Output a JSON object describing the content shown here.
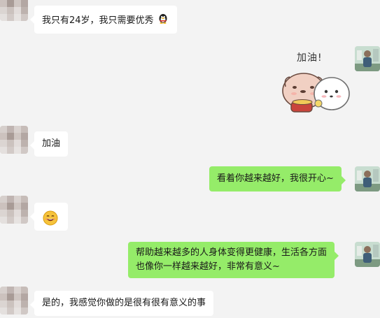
{
  "messages": [
    {
      "side": "left",
      "type": "text",
      "text": "我只有24岁，我只需要优秀",
      "emoji": "qq-penguin-icon"
    },
    {
      "side": "right",
      "type": "sticker",
      "sticker_text": "加油!",
      "sticker": "cheer-bears-sticker"
    },
    {
      "side": "left",
      "type": "text",
      "text": "加油"
    },
    {
      "side": "right",
      "type": "text",
      "text": "看着你越来越好，我很开心~"
    },
    {
      "side": "left",
      "type": "emoji",
      "emoji": "smile-emoji"
    },
    {
      "side": "right",
      "type": "text",
      "line1": "帮助越来越多的人身体变得更健康，生活各方面",
      "line2": "也像你一样越来越好，非常有意义~"
    },
    {
      "side": "left",
      "type": "text",
      "text": "是的，我感觉你做的是很有很有意义的事"
    }
  ],
  "colors": {
    "background": "#f3f3f3",
    "bubble_self": "#95ec69",
    "bubble_other": "#ffffff"
  }
}
